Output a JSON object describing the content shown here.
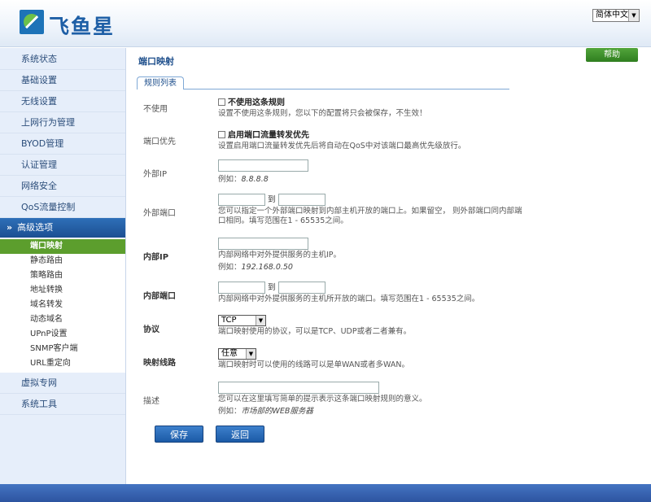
{
  "header": {
    "brand": "飞鱼星",
    "language": "简体中文"
  },
  "sidebar": {
    "items": [
      {
        "label": "系统状态"
      },
      {
        "label": "基础设置"
      },
      {
        "label": "无线设置"
      },
      {
        "label": "上网行为管理"
      },
      {
        "label": "BYOD管理"
      },
      {
        "label": "认证管理"
      },
      {
        "label": "网络安全"
      },
      {
        "label": "QoS流量控制"
      }
    ],
    "active_label": "高级选项",
    "sub_items": [
      {
        "label": "端口映射"
      },
      {
        "label": "静态路由"
      },
      {
        "label": "策略路由"
      },
      {
        "label": "地址转换"
      },
      {
        "label": "域名转发"
      },
      {
        "label": "动态域名"
      },
      {
        "label": "UPnP设置"
      },
      {
        "label": "SNMP客户端"
      },
      {
        "label": "URL重定向"
      }
    ],
    "bottom_items": [
      {
        "label": "虚拟专网"
      },
      {
        "label": "系统工具"
      }
    ]
  },
  "main": {
    "title": "端口映射",
    "help_label": "帮助",
    "tab_label": "规则列表",
    "form": {
      "disable": {
        "label": "不使用",
        "checkbox_label": "不使用这条规则",
        "note": "设置不使用这条规则，您以下的配置将只会被保存，不生效！"
      },
      "priority": {
        "label": "端口优先",
        "checkbox_label": "启用端口流量转发优先",
        "note": "设置启用端口流量转发优先后将自动在QoS中对该端口最高优先级放行。"
      },
      "external_ip": {
        "label": "外部IP",
        "value": "",
        "example_prefix": "例如：",
        "example": "8.8.8.8"
      },
      "external_port": {
        "label": "外部端口",
        "to": "到",
        "note1": "您可以指定一个外部端口映射到内部主机开放的端口上。如果留空， 则外部端口同内部端",
        "note2": "口相同。填写范围在1 - 65535之间。"
      },
      "internal_ip": {
        "label": "内部IP",
        "value": "",
        "note": "内部网络中对外提供服务的主机IP。",
        "example_prefix": "例如：",
        "example": "192.168.0.50"
      },
      "internal_port": {
        "label": "内部端口",
        "to": "到",
        "note": "内部网络中对外提供服务的主机所开放的端口。填写范围在1 - 65535之间。"
      },
      "protocol": {
        "label": "协议",
        "value": "TCP",
        "note": "端口映射使用的协议，可以是TCP、UDP或者二者兼有。"
      },
      "route": {
        "label": "映射线路",
        "value": "任意",
        "note": "端口映射时可以使用的线路可以是单WAN或者多WAN。"
      },
      "description": {
        "label": "描述",
        "value": "",
        "note": "您可以在这里填写简单的提示表示这条端口映射规则的意义。",
        "example_prefix": "例如：",
        "example": "市场部的WEB服务器"
      }
    },
    "save_label": "保存",
    "back_label": "返回"
  }
}
